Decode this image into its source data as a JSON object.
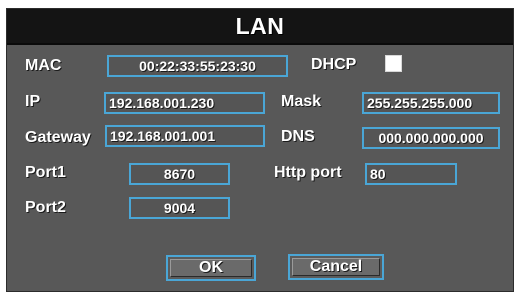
{
  "dialog": {
    "title": "LAN"
  },
  "labels": {
    "mac": "MAC",
    "dhcp": "DHCP",
    "ip": "IP",
    "mask": "Mask",
    "gateway": "Gateway",
    "dns": "DNS",
    "port1": "Port1",
    "http_port": "Http port",
    "port2": "Port2"
  },
  "fields": {
    "mac": "00:22:33:55:23:30",
    "dhcp_checked": false,
    "ip": "192.168.001.230",
    "mask": "255.255.255.000",
    "gateway": "192.168.001.001",
    "dns": "000.000.000.000",
    "port1": "8670",
    "http_port": "80",
    "port2": "9004"
  },
  "buttons": {
    "ok": "OK",
    "cancel": "Cancel"
  },
  "colors": {
    "field_border": "#4aa6d6",
    "panel_bg": "#585858",
    "title_bg": "#141414"
  }
}
